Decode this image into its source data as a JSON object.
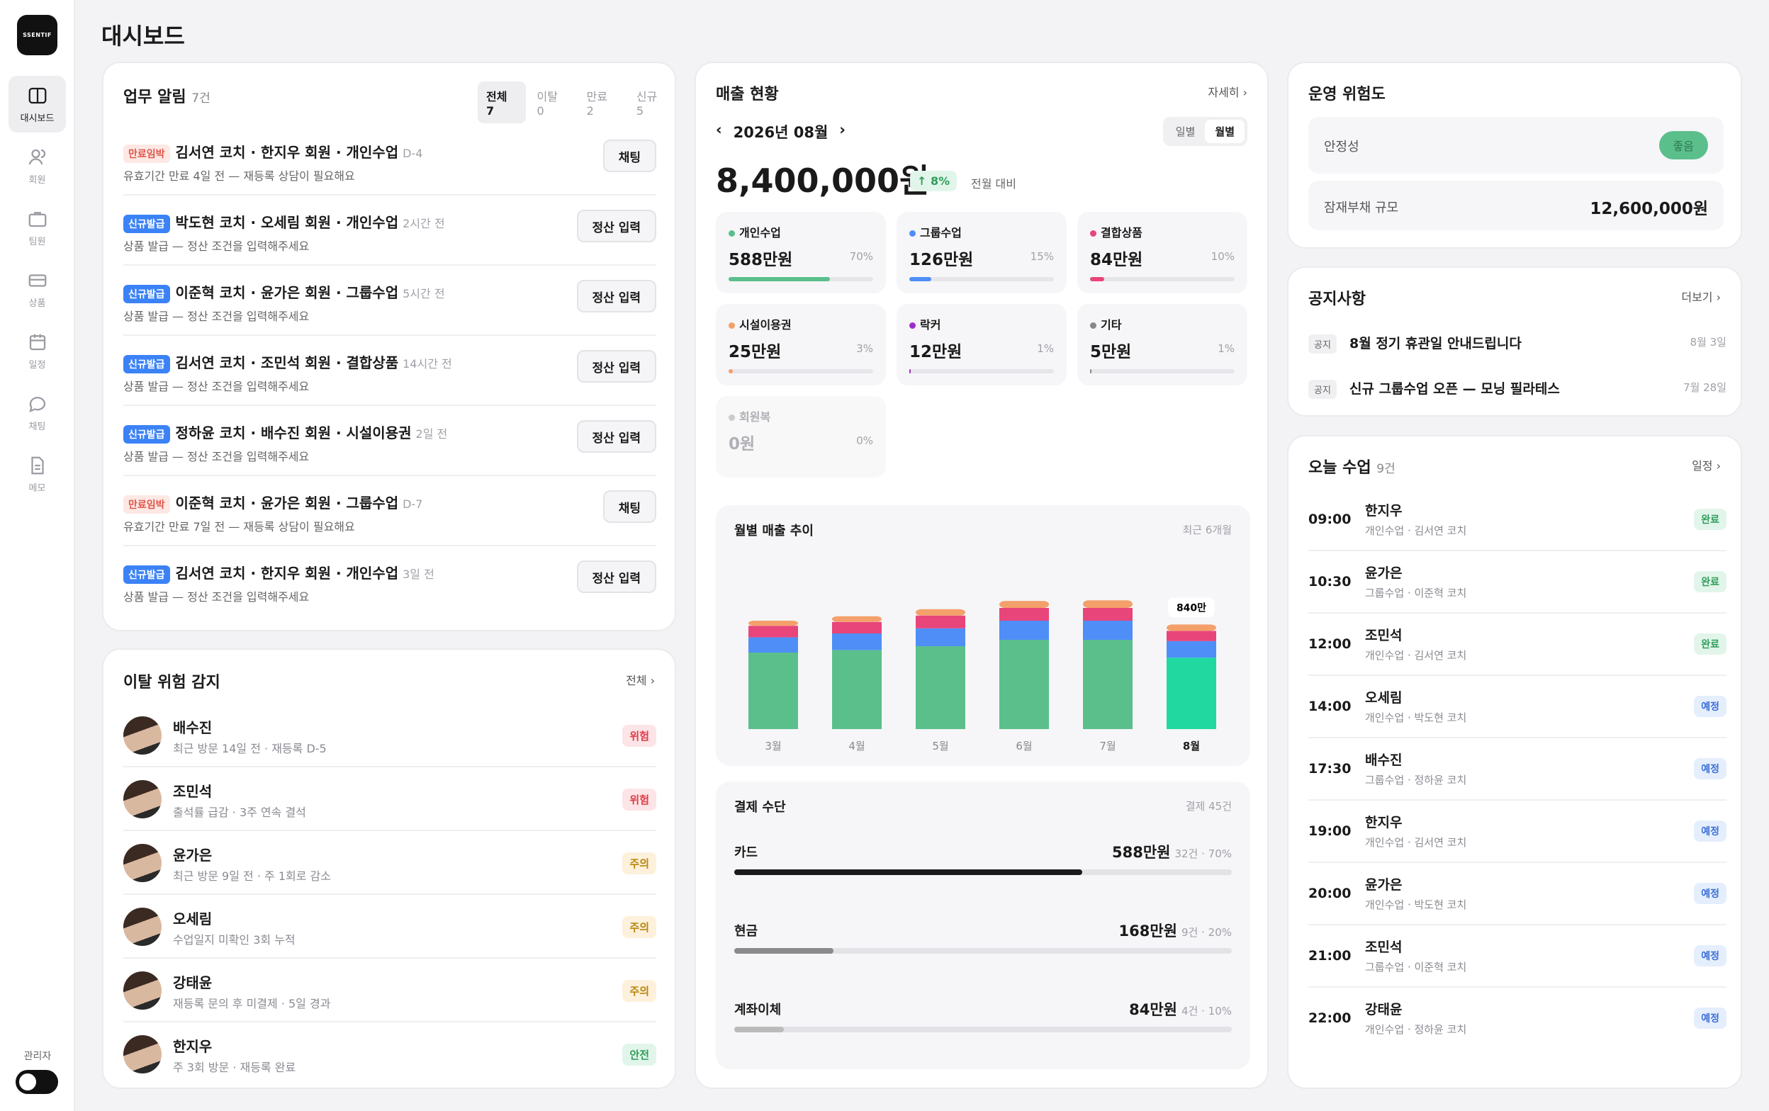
{
  "app": {
    "logo": "SSENTIF",
    "page_title": "대시보드",
    "admin_label": "관리자"
  },
  "nav": [
    {
      "label": "대시보드",
      "icon": "dashboard-icon"
    },
    {
      "label": "회원",
      "icon": "users-icon"
    },
    {
      "label": "팀원",
      "icon": "briefcase-icon"
    },
    {
      "label": "상품",
      "icon": "card-icon"
    },
    {
      "label": "일정",
      "icon": "calendar-icon"
    },
    {
      "label": "채팅",
      "icon": "chat-icon"
    },
    {
      "label": "메모",
      "icon": "memo-icon"
    }
  ],
  "tasks": {
    "title": "업무 알림",
    "count": "7건",
    "filters": [
      "전체 7",
      "이탈 0",
      "만료 2",
      "신규 5"
    ],
    "items": [
      {
        "tag": "만료임박",
        "type": "exp",
        "title": "김서연 코치 · 한지우 회원 · 개인수업",
        "meta": "D-4",
        "sub": "유효기간 만료 4일 전 — 재등록 상담이 필요해요",
        "button": "채팅"
      },
      {
        "tag": "신규발급",
        "type": "new",
        "title": "박도현 코치 · 오세림 회원 · 개인수업",
        "meta": "2시간 전",
        "sub": "상품 발급 — 정산 조건을 입력해주세요",
        "button": "정산 입력"
      },
      {
        "tag": "신규발급",
        "type": "new",
        "title": "이준혁 코치 · 윤가은 회원 · 그룹수업",
        "meta": "5시간 전",
        "sub": "상품 발급 — 정산 조건을 입력해주세요",
        "button": "정산 입력"
      },
      {
        "tag": "신규발급",
        "type": "new",
        "title": "김서연 코치 · 조민석 회원 · 결합상품",
        "meta": "14시간 전",
        "sub": "상품 발급 — 정산 조건을 입력해주세요",
        "button": "정산 입력"
      },
      {
        "tag": "신규발급",
        "type": "new",
        "title": "정하윤 코치 · 배수진 회원 · 시설이용권",
        "meta": "2일 전",
        "sub": "상품 발급 — 정산 조건을 입력해주세요",
        "button": "정산 입력"
      },
      {
        "tag": "만료임박",
        "type": "exp",
        "title": "이준혁 코치 · 윤가은 회원 · 그룹수업",
        "meta": "D-7",
        "sub": "유효기간 만료 7일 전 — 재등록 상담이 필요해요",
        "button": "채팅"
      },
      {
        "tag": "신규발급",
        "type": "new",
        "title": "김서연 코치 · 한지우 회원 · 개인수업",
        "meta": "3일 전",
        "sub": "상품 발급 — 정산 조건을 입력해주세요",
        "button": "정산 입력"
      }
    ]
  },
  "churn": {
    "title": "이탈 위험 감지",
    "more": "전체 ›",
    "items": [
      {
        "name": "배수진",
        "sub": "최근 방문 14일 전 · 재등록 D-5",
        "badge": "위험",
        "level": "danger"
      },
      {
        "name": "조민석",
        "sub": "출석률 급감 · 3주 연속 결석",
        "badge": "위험",
        "level": "danger"
      },
      {
        "name": "윤가은",
        "sub": "최근 방문 9일 전 · 주 1회로 감소",
        "badge": "주의",
        "level": "warn"
      },
      {
        "name": "오세림",
        "sub": "수업일지 미확인 3회 누적",
        "badge": "주의",
        "level": "warn"
      },
      {
        "name": "강태윤",
        "sub": "재등록 문의 후 미결제 · 5일 경과",
        "badge": "주의",
        "level": "warn"
      },
      {
        "name": "한지우",
        "sub": "주 3회 방문 · 재등록 완료",
        "badge": "안전",
        "level": "safe"
      }
    ]
  },
  "sales": {
    "title": "매출 현황",
    "more": "자세히 ›",
    "month": "2026년 08월",
    "prev": "‹",
    "next": "›",
    "toggle": [
      "일별",
      "월별"
    ],
    "total": "8,400,000원",
    "change": "↑ 8%",
    "change_label": "전월 대비",
    "categories": [
      {
        "label": "개인수업",
        "value": "588만원",
        "pct": "70%",
        "ratio": 0.7,
        "color": "#5bbf8c"
      },
      {
        "label": "그룹수업",
        "value": "126만원",
        "pct": "15%",
        "ratio": 0.15,
        "color": "#4f8ef7"
      },
      {
        "label": "결합상품",
        "value": "84만원",
        "pct": "10%",
        "ratio": 0.1,
        "color": "#e8457a"
      },
      {
        "label": "시설이용권",
        "value": "25만원",
        "pct": "3%",
        "ratio": 0.03,
        "color": "#f4a06a"
      },
      {
        "label": "락커",
        "value": "12만원",
        "pct": "1%",
        "ratio": 0.01,
        "color": "#9b30c9"
      },
      {
        "label": "기타",
        "value": "5만원",
        "pct": "1%",
        "ratio": 0.01,
        "color": "#888888"
      },
      {
        "label": "회원복",
        "value": "0원",
        "pct": "0%",
        "ratio": 0,
        "color": "#cccccc"
      }
    ]
  },
  "chart_data": {
    "type": "bar",
    "title": "월별 매출 추이",
    "subtitle": "최근 6개월",
    "highlight_label": "840만",
    "categories": [
      "3월",
      "4월",
      "5월",
      "6월",
      "7월",
      "8월"
    ],
    "series": [
      {
        "values": [
          600,
          620,
          650,
          700,
          700,
          560
        ],
        "color": "#5bbf8c"
      },
      {
        "values": [
          120,
          130,
          140,
          150,
          150,
          130
        ],
        "color": "#4f8ef7"
      },
      {
        "values": [
          90,
          90,
          100,
          100,
          100,
          80
        ],
        "color": "#e8457a"
      },
      {
        "values": [
          40,
          45,
          50,
          55,
          60,
          50
        ],
        "color": "#f4a06a"
      }
    ]
  },
  "payment": {
    "title": "결제 수단",
    "count": "결제 45건",
    "items": [
      {
        "label": "카드",
        "value": "588만원",
        "meta": "32건 · 70%",
        "ratio": 0.7,
        "color": "#1a1a1a"
      },
      {
        "label": "현금",
        "value": "168만원",
        "meta": "9건 · 20%",
        "ratio": 0.2,
        "color": "#8a8a8a"
      },
      {
        "label": "계좌이체",
        "value": "84만원",
        "meta": "4건 · 10%",
        "ratio": 0.1,
        "color": "#bbbbbb"
      }
    ]
  },
  "risk": {
    "title": "운영 위험도",
    "stability_label": "안정성",
    "stability_value": "좋음",
    "debt_label": "잠재부채 규모",
    "debt_value": "12,600,000원"
  },
  "notices": {
    "title": "공지사항",
    "more": "더보기 ›",
    "items": [
      {
        "tag": "공지",
        "text": "8월 정기 휴관일 안내드립니다",
        "date": "8월 3일"
      },
      {
        "tag": "공지",
        "text": "신규 그룹수업 오픈 — 모닝 필라테스",
        "date": "7월 28일"
      }
    ]
  },
  "classes": {
    "title": "오늘 수업",
    "count": "9건",
    "more": "일정 ›",
    "items": [
      {
        "time": "09:00",
        "name": "한지우",
        "sub": "개인수업 · 김서연 코치",
        "status": "완료",
        "kind": "done"
      },
      {
        "time": "10:30",
        "name": "윤가은",
        "sub": "그룹수업 · 이준혁 코치",
        "status": "완료",
        "kind": "done"
      },
      {
        "time": "12:00",
        "name": "조민석",
        "sub": "개인수업 · 김서연 코치",
        "status": "완료",
        "kind": "done"
      },
      {
        "time": "14:00",
        "name": "오세림",
        "sub": "개인수업 · 박도현 코치",
        "status": "예정",
        "kind": "plan"
      },
      {
        "time": "17:30",
        "name": "배수진",
        "sub": "그룹수업 · 정하윤 코치",
        "status": "예정",
        "kind": "plan"
      },
      {
        "time": "19:00",
        "name": "한지우",
        "sub": "개인수업 · 김서연 코치",
        "status": "예정",
        "kind": "plan"
      },
      {
        "time": "20:00",
        "name": "윤가은",
        "sub": "개인수업 · 박도현 코치",
        "status": "예정",
        "kind": "plan"
      },
      {
        "time": "21:00",
        "name": "조민석",
        "sub": "그룹수업 · 이준혁 코치",
        "status": "예정",
        "kind": "plan"
      },
      {
        "time": "22:00",
        "name": "강태윤",
        "sub": "개인수업 · 정하윤 코치",
        "status": "예정",
        "kind": "plan"
      }
    ]
  }
}
